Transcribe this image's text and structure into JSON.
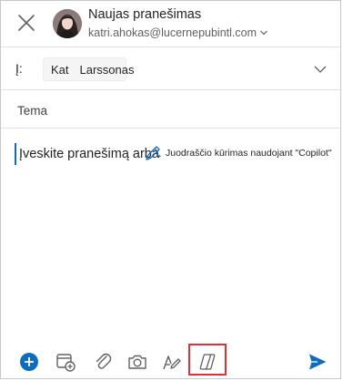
{
  "header": {
    "title": "Naujas pranešimas",
    "sender_email": "katri.ahokas@lucernepubintl.com"
  },
  "recipients": {
    "to_label": "Į:",
    "chip_first": "Kat",
    "chip_last": "Larssonas"
  },
  "subject": {
    "placeholder": "Tema"
  },
  "body": {
    "placeholder": "Įveskite pranešimą arba",
    "copilot_hint": "Juodraščio kūrimas naudojant \"Copilot\""
  },
  "toolbar": {
    "icons": [
      "add-icon",
      "calendar-add-icon",
      "attach-icon",
      "camera-icon",
      "draw-icon",
      "copilot-icon",
      "send-icon"
    ],
    "accent_color": "#0f6cbd",
    "highlight_color": "#d9333a"
  }
}
